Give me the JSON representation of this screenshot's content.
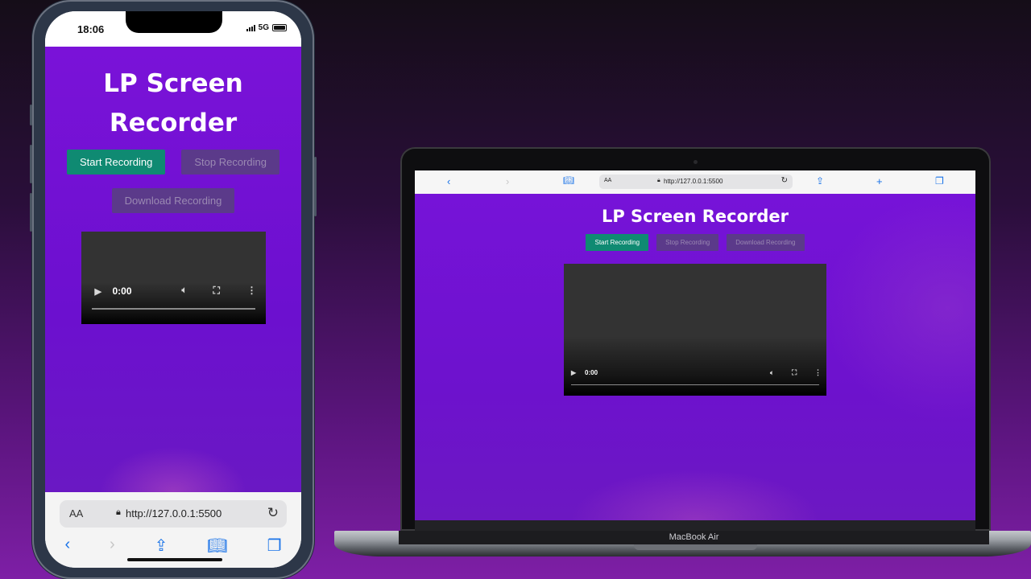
{
  "phone": {
    "status": {
      "time": "18:06",
      "network": "5G"
    },
    "page": {
      "title_line1": "LP Screen",
      "title_line2": "Recorder",
      "buttons": {
        "start": "Start Recording",
        "stop": "Stop Recording",
        "download": "Download Recording"
      },
      "video": {
        "time": "0:00"
      }
    },
    "browser": {
      "aa": "AA",
      "url": "http://127.0.0.1:5500"
    }
  },
  "laptop": {
    "browser": {
      "aa": "AA",
      "url": "http://127.0.0.1:5500"
    },
    "page": {
      "title": "LP Screen Recorder",
      "buttons": {
        "start": "Start Recording",
        "stop": "Stop Recording",
        "download": "Download Recording"
      },
      "video": {
        "time": "0:00"
      }
    },
    "label": "MacBook Air"
  },
  "colors": {
    "page_bg": "#7613d8",
    "start_button": "#0f8a72",
    "disabled_button": "#5b3a8a",
    "link_blue": "#1a73e8"
  },
  "icons": [
    "back-icon",
    "forward-icon",
    "book-icon",
    "share-icon",
    "plus-icon",
    "tabs-icon",
    "lock-icon",
    "reload-icon",
    "play-icon",
    "volume-icon",
    "fullscreen-icon",
    "more-icon"
  ]
}
